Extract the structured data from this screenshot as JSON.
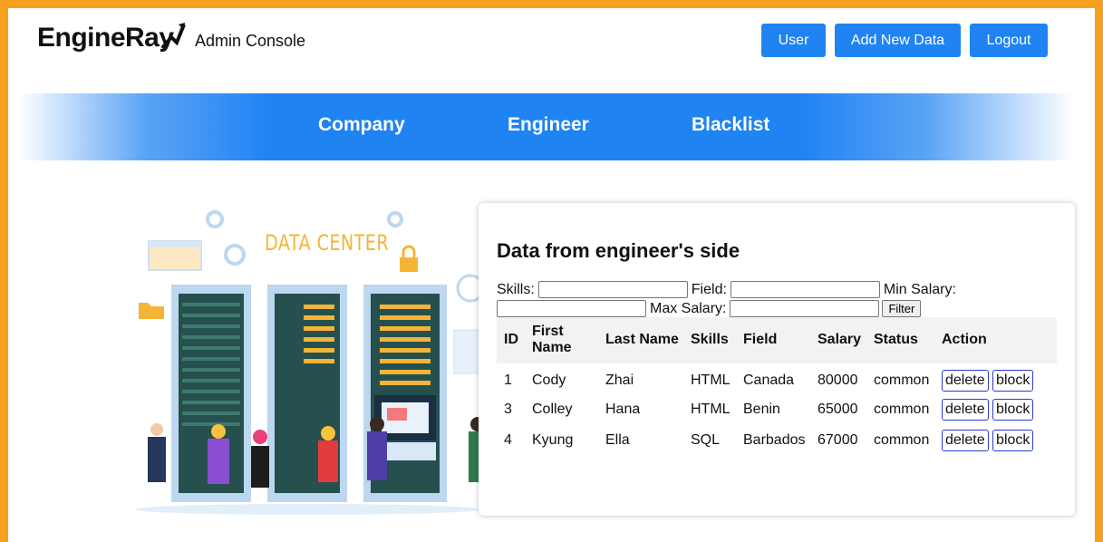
{
  "header": {
    "brand": "EngineRay",
    "subtitle": "Admin Console",
    "buttons": {
      "user": "User",
      "add": "Add New Data",
      "logout": "Logout"
    }
  },
  "nav": {
    "items": [
      "Company",
      "Engineer",
      "Blacklist"
    ]
  },
  "illustration": {
    "label": "DATA CENTER"
  },
  "card": {
    "title": "Data from engineer's side",
    "filters": {
      "skills_label": "Skills:",
      "field_label": "Field:",
      "min_salary_label": "Min Salary:",
      "max_salary_label": "Max Salary:",
      "filter_button": "Filter"
    },
    "table": {
      "headers": [
        "ID",
        "First Name",
        "Last Name",
        "Skills",
        "Field",
        "Salary",
        "Status",
        "Action"
      ],
      "rows": [
        [
          "1",
          "Cody",
          "Zhai",
          "HTML",
          "Canada",
          "80000",
          "common"
        ],
        [
          "3",
          "Colley",
          "Hana",
          "HTML",
          "Benin",
          "65000",
          "common"
        ],
        [
          "4",
          "Kyung",
          "Ella",
          "SQL",
          "Barbados",
          "67000",
          "common"
        ]
      ],
      "actions": {
        "delete": "delete",
        "block": "block"
      }
    }
  },
  "colors": {
    "accent": "#1f83f2",
    "frame": "#f5a01f",
    "illustration_label": "#f6b437"
  }
}
